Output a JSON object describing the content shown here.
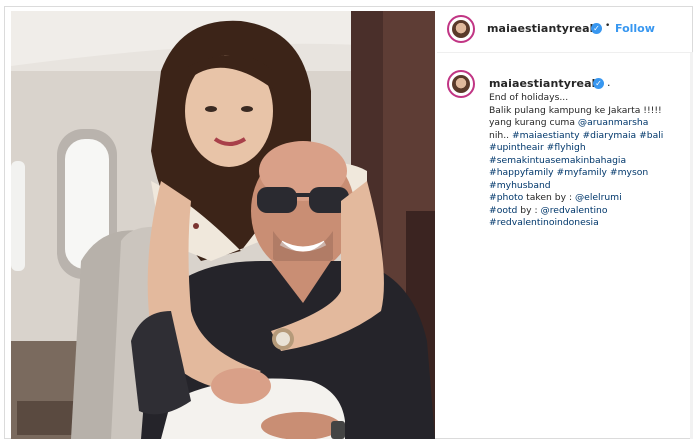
{
  "post": {
    "username": "maiaestiantyreal",
    "follow_label": "Follow",
    "separator": "•",
    "caption_dot": "."
  },
  "caption": {
    "lines": [
      "End of holidays...",
      "Balik pulang kampung ke Jakarta !!!!!",
      "yang kurang cuma @aruanmarsha",
      "nih.. #maiaestianty #diarymaia #bali",
      "#upintheair #flyhigh",
      "#semakintuasemakinbahagia",
      "#happyfamily #myfamily #myson",
      "#myhusband",
      "#photo taken by : @elelrumi",
      "#ootd by : @redvalentino",
      "#redvalentinoindonesia"
    ]
  },
  "icons": {
    "verified": "verified-badge-icon",
    "avatar": "profile-avatar"
  },
  "colors": {
    "link": "#3897f0",
    "hashtag": "#00376b",
    "text": "#262626"
  }
}
